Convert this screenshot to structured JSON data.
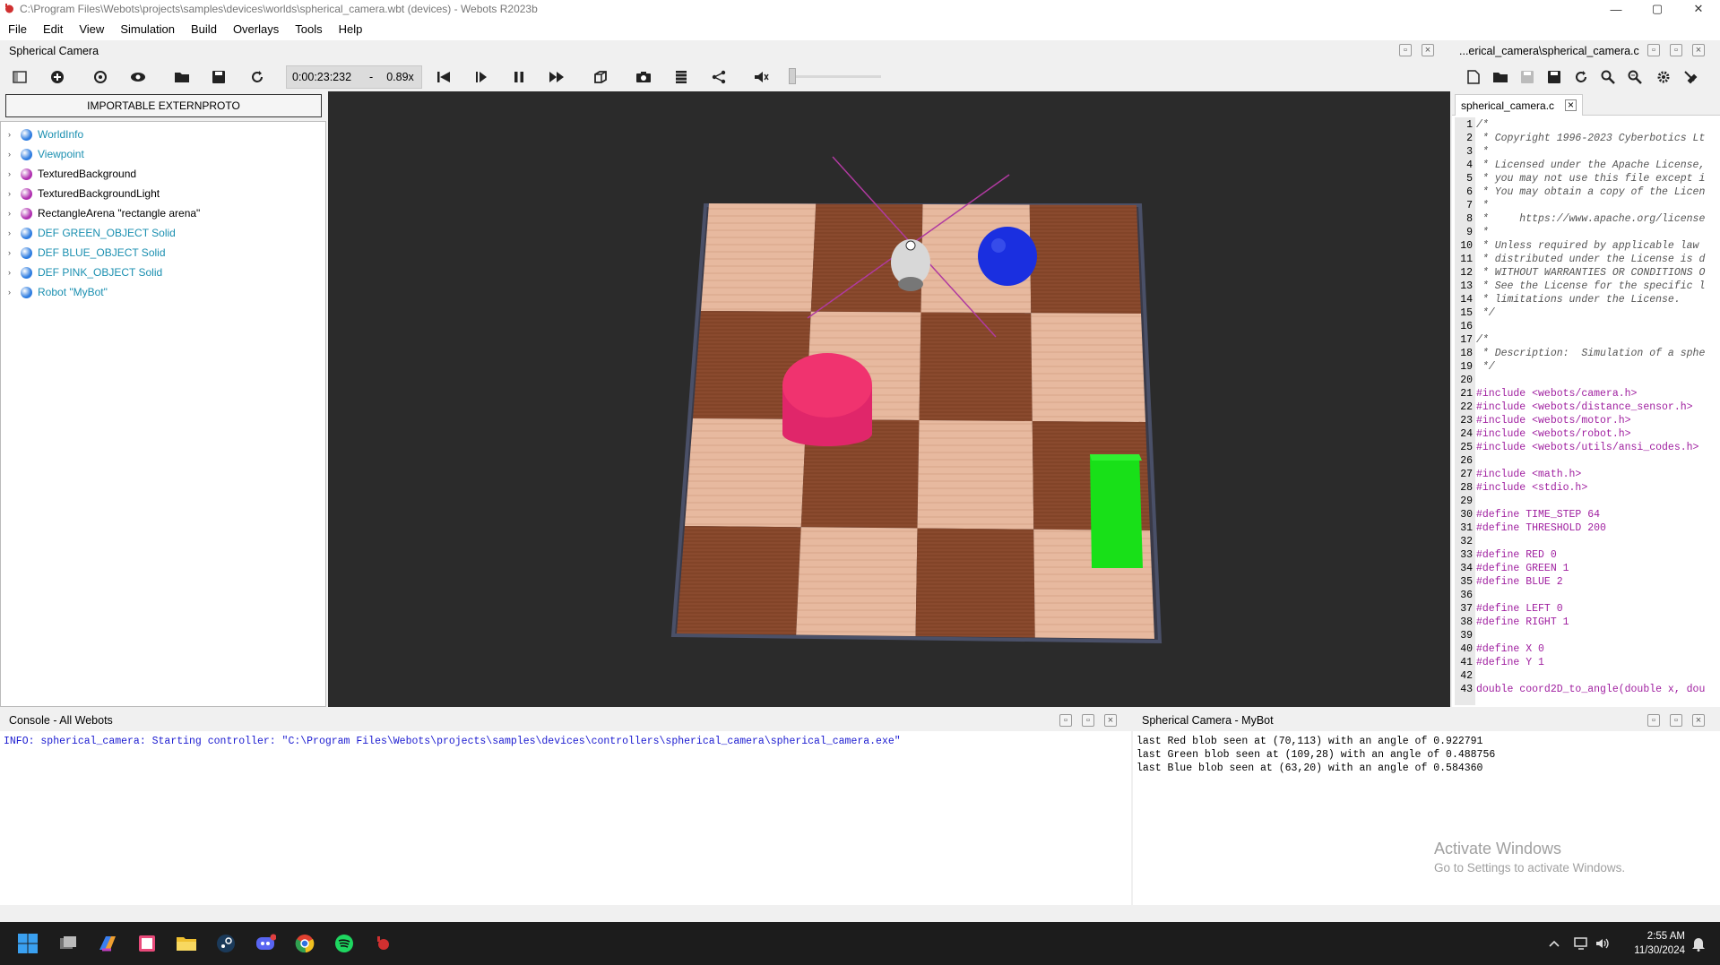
{
  "window": {
    "title": "C:\\Program Files\\Webots\\projects\\samples\\devices\\worlds\\spherical_camera.wbt (devices) - Webots R2023b",
    "minimize": "—",
    "maximize": "▢",
    "close": "✕"
  },
  "menu": [
    "File",
    "Edit",
    "View",
    "Simulation",
    "Build",
    "Overlays",
    "Tools",
    "Help"
  ],
  "left_panel": {
    "title": "Spherical Camera"
  },
  "toolbar": {
    "time": "0:00:23:232",
    "separator": "-",
    "speed": "0.89x"
  },
  "scene_tree": {
    "import_button": "IMPORTABLE EXTERNPROTO",
    "items": [
      {
        "label": "WorldInfo",
        "color": "#1a8fb0",
        "dot": "#2f7de0"
      },
      {
        "label": "Viewpoint",
        "color": "#1a8fb0",
        "dot": "#2f7de0"
      },
      {
        "label": "TexturedBackground",
        "color": "#000000",
        "dot": "#b030b0"
      },
      {
        "label": "TexturedBackgroundLight",
        "color": "#000000",
        "dot": "#b030b0"
      },
      {
        "label": "RectangleArena \"rectangle arena\"",
        "color": "#000000",
        "dot": "#b030b0"
      },
      {
        "label": "DEF GREEN_OBJECT Solid",
        "color": "#1a8fb0",
        "dot": "#2f7de0"
      },
      {
        "label": "DEF BLUE_OBJECT Solid",
        "color": "#1a8fb0",
        "dot": "#2f7de0"
      },
      {
        "label": "DEF PINK_OBJECT Solid",
        "color": "#1a8fb0",
        "dot": "#2f7de0"
      },
      {
        "label": "Robot \"MyBot\"",
        "color": "#1a8fb0",
        "dot": "#2f7de0"
      }
    ]
  },
  "editor": {
    "title": "...erical_camera\\spherical_camera.c",
    "tab": "spherical_camera.c",
    "tab_close": "×",
    "lines": [
      {
        "n": "1",
        "t": "/*",
        "k": "cmt"
      },
      {
        "n": "2",
        "t": " * Copyright 1996-2023 Cyberbotics Lt",
        "k": "cmt"
      },
      {
        "n": "3",
        "t": " *",
        "k": "cmt"
      },
      {
        "n": "4",
        "t": " * Licensed under the Apache License,",
        "k": "cmt"
      },
      {
        "n": "5",
        "t": " * you may not use this file except i",
        "k": "cmt"
      },
      {
        "n": "6",
        "t": " * You may obtain a copy of the Licen",
        "k": "cmt"
      },
      {
        "n": "7",
        "t": " *",
        "k": "cmt"
      },
      {
        "n": "8",
        "t": " *     https://www.apache.org/license",
        "k": "cmt"
      },
      {
        "n": "9",
        "t": " *",
        "k": "cmt"
      },
      {
        "n": "10",
        "t": " * Unless required by applicable law",
        "k": "cmt"
      },
      {
        "n": "11",
        "t": " * distributed under the License is d",
        "k": "cmt"
      },
      {
        "n": "12",
        "t": " * WITHOUT WARRANTIES OR CONDITIONS O",
        "k": "cmt"
      },
      {
        "n": "13",
        "t": " * See the License for the specific l",
        "k": "cmt"
      },
      {
        "n": "14",
        "t": " * limitations under the License.",
        "k": "cmt"
      },
      {
        "n": "15",
        "t": " */",
        "k": "cmt"
      },
      {
        "n": "16",
        "t": "",
        "k": "txt"
      },
      {
        "n": "17",
        "t": "/*",
        "k": "cmt"
      },
      {
        "n": "18",
        "t": " * Description:  Simulation of a sphe",
        "k": "cmt"
      },
      {
        "n": "19",
        "t": " */",
        "k": "cmt"
      },
      {
        "n": "20",
        "t": "",
        "k": "txt"
      },
      {
        "n": "21",
        "t": "#include <webots/camera.h>",
        "k": "pp"
      },
      {
        "n": "22",
        "t": "#include <webots/distance_sensor.h>",
        "k": "pp"
      },
      {
        "n": "23",
        "t": "#include <webots/motor.h>",
        "k": "pp"
      },
      {
        "n": "24",
        "t": "#include <webots/robot.h>",
        "k": "pp"
      },
      {
        "n": "25",
        "t": "#include <webots/utils/ansi_codes.h>",
        "k": "pp"
      },
      {
        "n": "26",
        "t": "",
        "k": "txt"
      },
      {
        "n": "27",
        "t": "#include <math.h>",
        "k": "pp"
      },
      {
        "n": "28",
        "t": "#include <stdio.h>",
        "k": "pp"
      },
      {
        "n": "29",
        "t": "",
        "k": "txt"
      },
      {
        "n": "30",
        "t": "#define TIME_STEP 64",
        "k": "pp"
      },
      {
        "n": "31",
        "t": "#define THRESHOLD 200",
        "k": "pp"
      },
      {
        "n": "32",
        "t": "",
        "k": "txt"
      },
      {
        "n": "33",
        "t": "#define RED 0",
        "k": "pp"
      },
      {
        "n": "34",
        "t": "#define GREEN 1",
        "k": "pp"
      },
      {
        "n": "35",
        "t": "#define BLUE 2",
        "k": "pp"
      },
      {
        "n": "36",
        "t": "",
        "k": "txt"
      },
      {
        "n": "37",
        "t": "#define LEFT 0",
        "k": "pp"
      },
      {
        "n": "38",
        "t": "#define RIGHT 1",
        "k": "pp"
      },
      {
        "n": "39",
        "t": "",
        "k": "txt"
      },
      {
        "n": "40",
        "t": "#define X 0",
        "k": "pp"
      },
      {
        "n": "41",
        "t": "#define Y 1",
        "k": "pp"
      },
      {
        "n": "42",
        "t": "",
        "k": "txt"
      },
      {
        "n": "43",
        "t": "double coord2D_to_angle(double x, dou",
        "k": "ty"
      }
    ]
  },
  "console": {
    "title": "Console - All Webots",
    "text": "INFO: spherical_camera: Starting controller: \"C:\\Program Files\\Webots\\projects\\samples\\devices\\controllers\\spherical_camera\\spherical_camera.exe\""
  },
  "robot_console": {
    "title": "Spherical Camera - MyBot",
    "lines": [
      "last Red blob seen at (70,113) with an angle of 0.922791",
      "last Green blob seen at (109,28) with an angle of 0.488756",
      "last Blue blob seen at (63,20) with an angle of 0.584360"
    ]
  },
  "watermark": {
    "line1": "Activate Windows",
    "line2": "Go to Settings to activate Windows."
  },
  "taskbar": {
    "time": "2:55 AM",
    "date": "11/30/2024"
  }
}
